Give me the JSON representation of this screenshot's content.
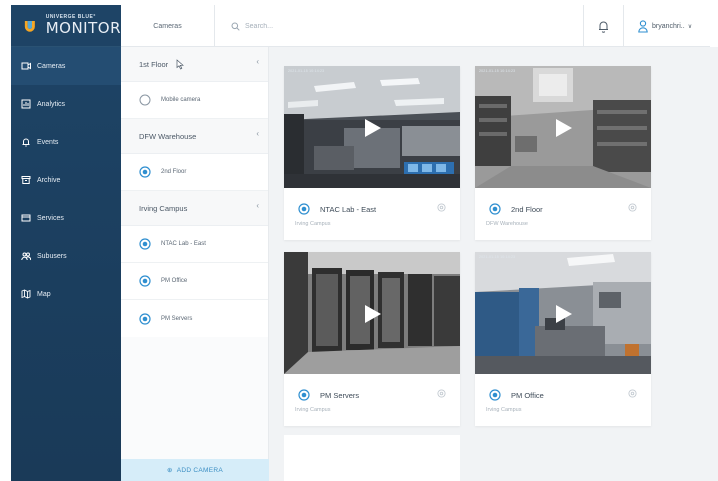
{
  "brand": {
    "small_text": "UNIVERGE BLUE°",
    "big_text": "MONITOR",
    "colors": {
      "sidebar": "#1e4466",
      "accent": "#2f8fd0",
      "add_bar": "#d6edf9"
    }
  },
  "sidebar": {
    "items": [
      {
        "label": "Cameras",
        "icon": "camera-icon",
        "active": true
      },
      {
        "label": "Analytics",
        "icon": "analytics-icon"
      },
      {
        "label": "Events",
        "icon": "bell-icon"
      },
      {
        "label": "Archive",
        "icon": "archive-icon"
      },
      {
        "label": "Services",
        "icon": "services-icon"
      },
      {
        "label": "Subusers",
        "icon": "users-icon"
      },
      {
        "label": "Map",
        "icon": "map-icon"
      }
    ]
  },
  "topbar": {
    "section_label": "Cameras",
    "search_placeholder": "Search...",
    "bell_icon": "bell-icon",
    "username": "bryanchri..",
    "user_icon": "user-icon"
  },
  "locations": {
    "groups": [
      {
        "name": "1st Floor",
        "cameras": [
          "Mobile camera"
        ]
      },
      {
        "name": "DFW Warehouse",
        "cameras": [
          "2nd Floor"
        ]
      },
      {
        "name": "Irving Campus",
        "cameras": [
          "NTAC Lab - East",
          "PM Office",
          "PM Servers"
        ]
      }
    ],
    "add_camera_label": "ADD CAMERA"
  },
  "cameras": [
    {
      "title": "NTAC Lab - East",
      "location": "Irving Campus",
      "scene": "office",
      "stamp": "2021-01-15 10:14:23"
    },
    {
      "title": "2nd Floor",
      "location": "DFW Warehouse",
      "scene": "warehouse",
      "stamp": "2021-01-15 10:14:23"
    },
    {
      "title": "PM Servers",
      "location": "Irving Campus",
      "scene": "servers",
      "stamp": ""
    },
    {
      "title": "PM Office",
      "location": "Irving Campus",
      "scene": "pm-office",
      "stamp": "2021-01-15 10:14:23"
    }
  ]
}
